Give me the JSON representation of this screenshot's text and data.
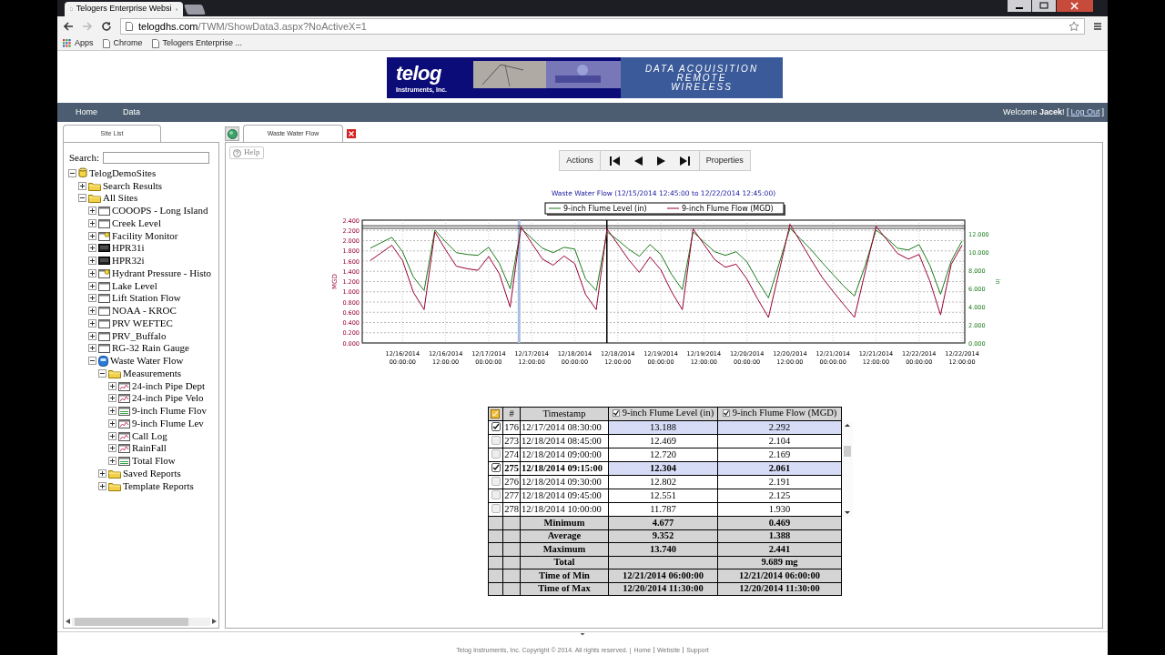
{
  "browser": {
    "tab_title": "Telogers Enterprise Websi",
    "url_domain": "telogdhs.com",
    "url_path": "/TWM/ShowData3.aspx?NoActiveX=1",
    "bookmarks": [
      {
        "kind": "apps",
        "label": "Apps"
      },
      {
        "kind": "page",
        "label": "Chrome"
      },
      {
        "kind": "page",
        "label": "Telogers Enterprise ..."
      }
    ]
  },
  "banner": {
    "logo": "telog",
    "logo_sub": "Instruments, Inc.",
    "tagline": [
      "DATA ACQUISITION",
      "REMOTE",
      "WIRELESS"
    ]
  },
  "nav": {
    "items": [
      "Home",
      "Data"
    ],
    "welcome": "Welcome **Jacek**! [",
    "logout": "Log Out",
    "welcome_end": "]"
  },
  "site_list": {
    "tab": "Site List",
    "search_label": "Search:",
    "tree": [
      {
        "label": "TelogDemoSites",
        "kind": "database",
        "expanded": true,
        "children": [
          {
            "label": "Search Results",
            "kind": "folder",
            "expanded": false
          },
          {
            "label": "All Sites",
            "kind": "folder",
            "expanded": true,
            "children": [
              {
                "label": "COOOPS - Long Island",
                "kind": "site",
                "expanded": false
              },
              {
                "label": "Creek Level",
                "kind": "site",
                "expanded": false
              },
              {
                "label": "Facility Monitor",
                "kind": "site-alert",
                "expanded": false
              },
              {
                "label": "HPR31i",
                "kind": "device",
                "expanded": false
              },
              {
                "label": "HPR32i",
                "kind": "device",
                "expanded": false
              },
              {
                "label": "Hydrant Pressure - Histo",
                "kind": "site-alert",
                "expanded": false
              },
              {
                "label": "Lake Level",
                "kind": "site",
                "expanded": false
              },
              {
                "label": "Lift Station Flow",
                "kind": "site",
                "expanded": false
              },
              {
                "label": "NOAA - KROC",
                "kind": "site",
                "expanded": false
              },
              {
                "label": "PRV WEFTEC",
                "kind": "site",
                "expanded": false
              },
              {
                "label": "PRV_Buffalo",
                "kind": "site",
                "expanded": false
              },
              {
                "label": "RG-32 Rain Gauge",
                "kind": "site",
                "expanded": false
              },
              {
                "label": "Waste Water Flow",
                "kind": "site-active",
                "expanded": true,
                "children": [
                  {
                    "label": "Measurements",
                    "kind": "folder",
                    "expanded": true,
                    "children": [
                      {
                        "label": "24-inch Pipe Dept",
                        "kind": "measure-red",
                        "expanded": false
                      },
                      {
                        "label": "24-inch Pipe Velo",
                        "kind": "measure-red",
                        "expanded": false
                      },
                      {
                        "label": "9-inch Flume Flov",
                        "kind": "measure-green",
                        "expanded": false
                      },
                      {
                        "label": "9-inch Flume Lev",
                        "kind": "measure-red",
                        "expanded": false
                      },
                      {
                        "label": "Call Log",
                        "kind": "measure-red",
                        "expanded": false
                      },
                      {
                        "label": "RainFall",
                        "kind": "measure-red",
                        "expanded": false
                      },
                      {
                        "label": "Total Flow",
                        "kind": "measure-green",
                        "expanded": false
                      }
                    ]
                  },
                  {
                    "label": "Saved Reports",
                    "kind": "folder",
                    "expanded": false
                  },
                  {
                    "label": "Template Reports",
                    "kind": "folder",
                    "expanded": false
                  }
                ]
              }
            ]
          }
        ]
      }
    ]
  },
  "main": {
    "tab": "Waste Water Flow",
    "help": "Help",
    "toolbar": {
      "actions": "Actions",
      "properties": "Properties"
    },
    "chart_data": {
      "type": "line",
      "title": "Waste Water Flow (12/15/2014 12:45:00 to 12/22/2014 12:45:00)",
      "ylabel": "MGD",
      "y2label": "in",
      "ylim": [
        0,
        2.4
      ],
      "y2lim": [
        0,
        13.6
      ],
      "categories": [
        null,
        null,
        null,
        "12/16/2014 00:00:00",
        null,
        null,
        null,
        "12/16/2014 12:00:00",
        null,
        null,
        null,
        "12/17/2014 00:00:00",
        null,
        null,
        null,
        "12/17/2014 12:00:00",
        null,
        null,
        null,
        "12/18/2014 00:00:00",
        null,
        null,
        null,
        "12/18/2014 12:00:00",
        null,
        null,
        null,
        "12/19/2014 00:00:00",
        null,
        null,
        null,
        "12/19/2014 12:00:00",
        null,
        null,
        null,
        "12/20/2014 00:00:00",
        null,
        null,
        null,
        "12/20/2014 12:00:00",
        null,
        null,
        null,
        "12/21/2014 00:00:00",
        null,
        null,
        null,
        "12/21/2014 12:00:00",
        null,
        null,
        null,
        "12/22/2014 00:00:00",
        null,
        null,
        null,
        "12/22/2014 12:00:00"
      ],
      "series": [
        {
          "name": "9-inch Flume Level (in)",
          "color": "#1a7a1a",
          "axis": "y2",
          "values": [
            10.5,
            11.1,
            11.7,
            10.1,
            7.3,
            5.8,
            12.5,
            11.2,
            10.0,
            9.8,
            9.7,
            10.6,
            8.8,
            6.0,
            12.7,
            11.6,
            10.5,
            10.0,
            10.6,
            10.4,
            7.1,
            5.8,
            12.3,
            11.4,
            10.4,
            9.6,
            10.9,
            9.8,
            7.6,
            5.9,
            12.3,
            11.2,
            10.1,
            9.7,
            10.1,
            9.0,
            6.9,
            5.0,
            8.8,
            12.7,
            11.5,
            10.3,
            8.9,
            7.6,
            6.3,
            5.2,
            8.6,
            12.5,
            11.6,
            10.5,
            10.3,
            10.9,
            8.6,
            5.4,
            9.1,
            11.3
          ]
        },
        {
          "name": "9-inch Flume Flow (MGD)",
          "color": "#990033",
          "values": [
            1.61,
            1.76,
            1.91,
            1.61,
            0.99,
            0.65,
            2.17,
            1.82,
            1.5,
            1.45,
            1.42,
            1.69,
            1.35,
            0.7,
            2.27,
            1.95,
            1.64,
            1.52,
            1.7,
            1.55,
            0.95,
            0.65,
            2.23,
            1.93,
            1.63,
            1.38,
            1.68,
            1.43,
            1.0,
            0.65,
            2.23,
            1.93,
            1.63,
            1.48,
            1.54,
            1.25,
            0.86,
            0.5,
            1.4,
            2.32,
            1.97,
            1.62,
            1.28,
            1.01,
            0.75,
            0.5,
            1.4,
            2.28,
            2.02,
            1.75,
            1.64,
            1.73,
            1.21,
            0.55,
            1.54,
            1.91
          ]
        }
      ],
      "yticks": [
        {
          "value": 0,
          "label": "0.000"
        },
        {
          "value": 0.2,
          "label": "0.200"
        },
        {
          "value": 0.4,
          "label": "0.400"
        },
        {
          "value": 0.6,
          "label": "0.600"
        },
        {
          "value": 0.8,
          "label": "0.800"
        },
        {
          "value": 1.0,
          "label": "1.000"
        },
        {
          "value": 1.2,
          "label": "1.200"
        },
        {
          "value": 1.4,
          "label": "1.400"
        },
        {
          "value": 1.6,
          "label": "1.600"
        },
        {
          "value": 1.8,
          "label": "1.800"
        },
        {
          "value": 2.0,
          "label": "2.000"
        },
        {
          "value": 2.2,
          "label": "2.200"
        },
        {
          "value": 2.4,
          "label": "2.400"
        }
      ],
      "y2ticks": [
        {
          "value": 0,
          "label": "0.000"
        },
        {
          "value": 2,
          "label": "2.000"
        },
        {
          "value": 4,
          "label": "4.000"
        },
        {
          "value": 6,
          "label": "6.000"
        },
        {
          "value": 8,
          "label": "8.000"
        },
        {
          "value": 10,
          "label": "10.000"
        },
        {
          "value": 12,
          "label": "12.000"
        }
      ],
      "grid": true,
      "legend": true,
      "ref_lines": [
        {
          "axis": "y",
          "value": 2.29
        },
        {
          "axis": "y",
          "value": 2.24
        }
      ]
    },
    "table": {
      "columns": [
        {
          "label": "#"
        },
        {
          "label": "Timestamp"
        },
        {
          "label": "9-inch Flume Level (in)",
          "checked": true
        },
        {
          "label": "9-inch Flume Flow (MGD)",
          "checked": true
        }
      ],
      "rows": [
        {
          "checked": true,
          "selected": true,
          "current": false,
          "num": "176",
          "timestamp": "12/17/2014 08:30:00",
          "level": "13.188",
          "flow": "2.292"
        },
        {
          "checked": false,
          "selected": false,
          "current": false,
          "num": "273",
          "timestamp": "12/18/2014 08:45:00",
          "level": "12.469",
          "flow": "2.104"
        },
        {
          "checked": false,
          "selected": false,
          "current": false,
          "num": "274",
          "timestamp": "12/18/2014 09:00:00",
          "level": "12.720",
          "flow": "2.169"
        },
        {
          "checked": true,
          "selected": true,
          "current": true,
          "num": "275",
          "timestamp": "12/18/2014 09:15:00",
          "level": "12.304",
          "flow": "2.061"
        },
        {
          "checked": false,
          "selected": false,
          "current": false,
          "num": "276",
          "timestamp": "12/18/2014 09:30:00",
          "level": "12.802",
          "flow": "2.191"
        },
        {
          "checked": false,
          "selected": false,
          "current": false,
          "num": "277",
          "timestamp": "12/18/2014 09:45:00",
          "level": "12.551",
          "flow": "2.125"
        },
        {
          "checked": false,
          "selected": false,
          "current": false,
          "num": "278",
          "timestamp": "12/18/2014 10:00:00",
          "level": "11.787",
          "flow": "1.930"
        }
      ],
      "summary": [
        {
          "label": "Minimum",
          "level": "4.677",
          "flow": "0.469"
        },
        {
          "label": "Average",
          "level": "9.352",
          "flow": "1.388"
        },
        {
          "label": "Maximum",
          "level": "13.740",
          "flow": "2.441"
        },
        {
          "label": "Total",
          "flow": "9.689 mg"
        },
        {
          "label": "Time of Min",
          "level": "12/21/2014 06:00:00",
          "flow": "12/21/2014 06:00:00"
        },
        {
          "label": "Time of Max",
          "level": "12/20/2014 11:30:00",
          "flow": "12/20/2014 11:30:00"
        }
      ]
    }
  },
  "footer": {
    "text": "Telog Instruments, Inc. Copyright © 2014. All rights reserved. |",
    "links": [
      "Home",
      "Website",
      "Support"
    ]
  }
}
